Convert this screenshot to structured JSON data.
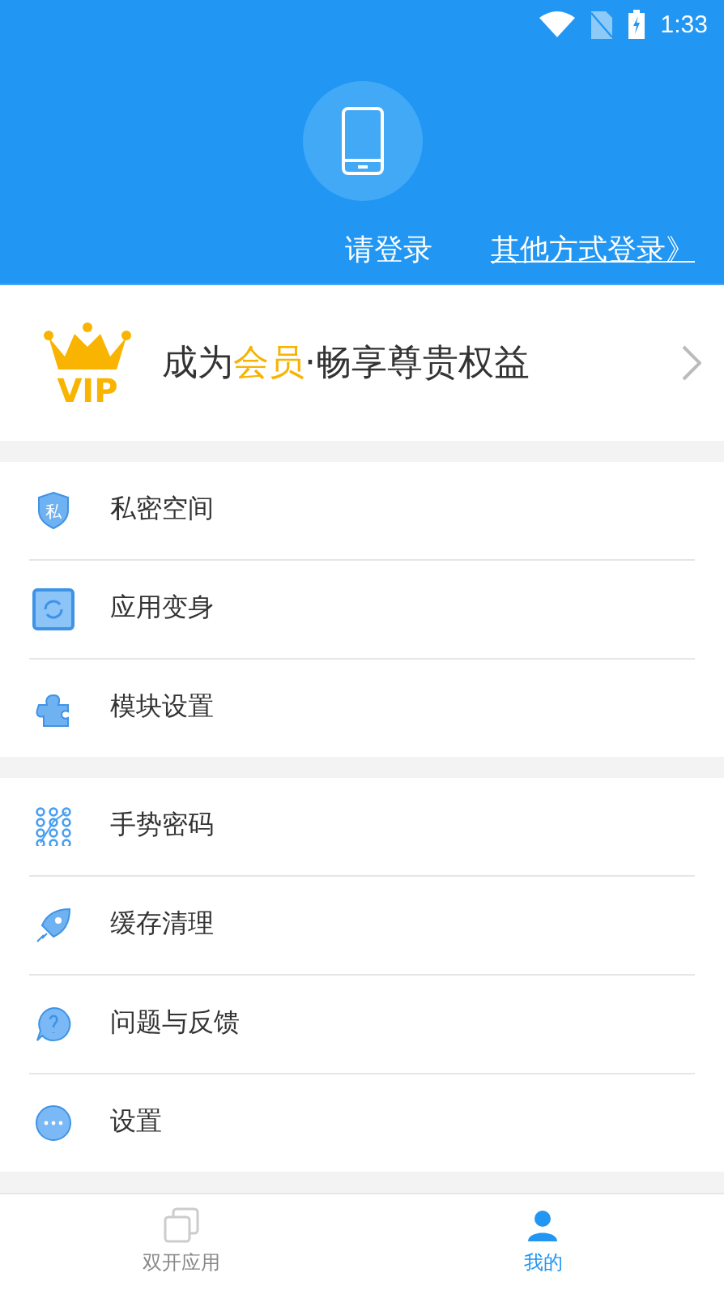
{
  "status_bar": {
    "time": "1:33"
  },
  "header": {
    "login_prompt": "请登录",
    "other_login_link": "其他方式登录》"
  },
  "vip_banner": {
    "badge": "VIP",
    "text_before": "成为",
    "text_highlight": "会员",
    "text_after": "·畅享尊贵权益"
  },
  "menu_groups": [
    {
      "items": [
        {
          "label": "私密空间",
          "icon_text": "私"
        },
        {
          "label": "应用变身"
        },
        {
          "label": "模块设置"
        }
      ]
    },
    {
      "items": [
        {
          "label": "手势密码"
        },
        {
          "label": "缓存清理"
        },
        {
          "label": "问题与反馈"
        },
        {
          "label": "设置"
        }
      ]
    }
  ],
  "bottom_nav": [
    {
      "label": "双开应用",
      "selected": false
    },
    {
      "label": "我的",
      "selected": true
    }
  ]
}
